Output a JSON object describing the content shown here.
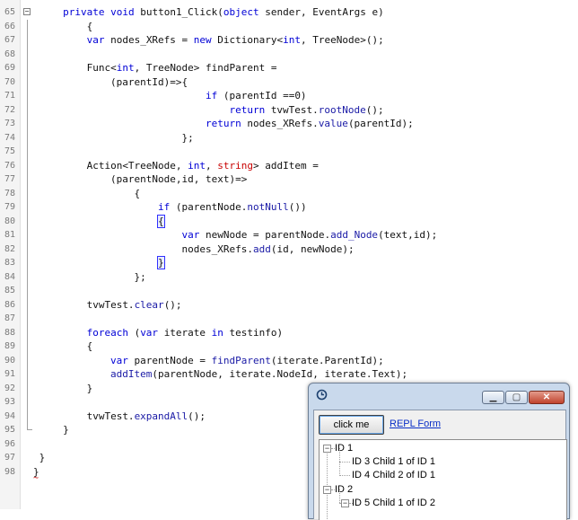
{
  "editor": {
    "lines": [
      {
        "num": "65",
        "indent": 5,
        "tokens": [
          {
            "c": "kw",
            "t": "private "
          },
          {
            "c": "kw",
            "t": "void "
          },
          {
            "c": "",
            "t": "button1_Click("
          },
          {
            "c": "kw",
            "t": "object "
          },
          {
            "c": "",
            "t": "sender, EventArgs e)"
          }
        ]
      },
      {
        "num": "66",
        "indent": 9,
        "tokens": [
          {
            "c": "",
            "t": "{"
          }
        ]
      },
      {
        "num": "67",
        "indent": 9,
        "tokens": [
          {
            "c": "kw",
            "t": "var "
          },
          {
            "c": "",
            "t": "nodes_XRefs = "
          },
          {
            "c": "kw",
            "t": "new "
          },
          {
            "c": "",
            "t": "Dictionary<"
          },
          {
            "c": "kw",
            "t": "int"
          },
          {
            "c": "",
            "t": ", TreeNode>();"
          }
        ]
      },
      {
        "num": "68",
        "indent": 0,
        "tokens": []
      },
      {
        "num": "69",
        "indent": 9,
        "tokens": [
          {
            "c": "",
            "t": "Func<"
          },
          {
            "c": "kw",
            "t": "int"
          },
          {
            "c": "",
            "t": ", TreeNode> findParent ="
          }
        ]
      },
      {
        "num": "70",
        "indent": 13,
        "tokens": [
          {
            "c": "",
            "t": "(parentId)=>{"
          }
        ]
      },
      {
        "num": "71",
        "indent": 29,
        "tokens": [
          {
            "c": "kw",
            "t": "if "
          },
          {
            "c": "",
            "t": "(parentId ==0)"
          }
        ]
      },
      {
        "num": "72",
        "indent": 33,
        "tokens": [
          {
            "c": "kw",
            "t": "return "
          },
          {
            "c": "",
            "t": "tvwTest."
          },
          {
            "c": "fn",
            "t": "rootNode"
          },
          {
            "c": "",
            "t": "();"
          }
        ]
      },
      {
        "num": "73",
        "indent": 29,
        "tokens": [
          {
            "c": "kw",
            "t": "return "
          },
          {
            "c": "",
            "t": "nodes_XRefs."
          },
          {
            "c": "fn",
            "t": "value"
          },
          {
            "c": "",
            "t": "(parentId);"
          }
        ]
      },
      {
        "num": "74",
        "indent": 25,
        "tokens": [
          {
            "c": "",
            "t": "};"
          }
        ]
      },
      {
        "num": "75",
        "indent": 0,
        "tokens": []
      },
      {
        "num": "76",
        "indent": 9,
        "tokens": [
          {
            "c": "",
            "t": "Action<TreeNode, "
          },
          {
            "c": "kw",
            "t": "int"
          },
          {
            "c": "",
            "t": ", "
          },
          {
            "c": "red",
            "t": "string"
          },
          {
            "c": "",
            "t": "> addItem ="
          }
        ]
      },
      {
        "num": "77",
        "indent": 13,
        "tokens": [
          {
            "c": "",
            "t": "(parentNode,id, text)=>"
          }
        ]
      },
      {
        "num": "78",
        "indent": 17,
        "tokens": [
          {
            "c": "",
            "t": "{"
          }
        ]
      },
      {
        "num": "79",
        "indent": 21,
        "tokens": [
          {
            "c": "kw",
            "t": "if "
          },
          {
            "c": "",
            "t": "(parentNode."
          },
          {
            "c": "fn",
            "t": "notNull"
          },
          {
            "c": "",
            "t": "())"
          }
        ]
      },
      {
        "num": "80",
        "indent": 21,
        "tokens": [
          {
            "c": "bracehl",
            "t": "{"
          }
        ]
      },
      {
        "num": "81",
        "indent": 25,
        "tokens": [
          {
            "c": "kw",
            "t": "var "
          },
          {
            "c": "",
            "t": "newNode = parentNode."
          },
          {
            "c": "fn",
            "t": "add_Node"
          },
          {
            "c": "",
            "t": "(text,id);"
          }
        ]
      },
      {
        "num": "82",
        "indent": 25,
        "tokens": [
          {
            "c": "",
            "t": "nodes_XRefs."
          },
          {
            "c": "fn",
            "t": "add"
          },
          {
            "c": "",
            "t": "(id, newNode);"
          }
        ]
      },
      {
        "num": "83",
        "indent": 21,
        "tokens": [
          {
            "c": "bracehl",
            "t": "}"
          }
        ]
      },
      {
        "num": "84",
        "indent": 17,
        "tokens": [
          {
            "c": "",
            "t": "};"
          }
        ]
      },
      {
        "num": "85",
        "indent": 0,
        "tokens": []
      },
      {
        "num": "86",
        "indent": 9,
        "tokens": [
          {
            "c": "",
            "t": "tvwTest."
          },
          {
            "c": "fn",
            "t": "clear"
          },
          {
            "c": "",
            "t": "();"
          }
        ]
      },
      {
        "num": "87",
        "indent": 0,
        "tokens": []
      },
      {
        "num": "88",
        "indent": 9,
        "tokens": [
          {
            "c": "kw",
            "t": "foreach "
          },
          {
            "c": "",
            "t": "("
          },
          {
            "c": "kw",
            "t": "var "
          },
          {
            "c": "",
            "t": "iterate "
          },
          {
            "c": "kw",
            "t": "in "
          },
          {
            "c": "",
            "t": "testinfo)"
          }
        ]
      },
      {
        "num": "89",
        "indent": 9,
        "tokens": [
          {
            "c": "",
            "t": "{"
          }
        ]
      },
      {
        "num": "90",
        "indent": 13,
        "tokens": [
          {
            "c": "kw",
            "t": "var "
          },
          {
            "c": "",
            "t": "parentNode = "
          },
          {
            "c": "fn",
            "t": "findParent"
          },
          {
            "c": "",
            "t": "(iterate.ParentId);"
          }
        ]
      },
      {
        "num": "91",
        "indent": 13,
        "tokens": [
          {
            "c": "fn",
            "t": "addItem"
          },
          {
            "c": "",
            "t": "(parentNode, iterate.NodeId, iterate.Text);"
          }
        ]
      },
      {
        "num": "92",
        "indent": 9,
        "tokens": [
          {
            "c": "",
            "t": "}"
          }
        ]
      },
      {
        "num": "93",
        "indent": 0,
        "tokens": []
      },
      {
        "num": "94",
        "indent": 9,
        "tokens": [
          {
            "c": "",
            "t": "tvwTest."
          },
          {
            "c": "fn",
            "t": "expandAll"
          },
          {
            "c": "",
            "t": "();"
          }
        ]
      },
      {
        "num": "95",
        "indent": 5,
        "tokens": [
          {
            "c": "",
            "t": "}"
          }
        ]
      },
      {
        "num": "96",
        "indent": 0,
        "tokens": []
      },
      {
        "num": "97",
        "indent": 1,
        "tokens": [
          {
            "c": "",
            "t": "}"
          }
        ]
      },
      {
        "num": "98",
        "indent": 0,
        "tokens": [
          {
            "c": "",
            "t": "}"
          }
        ]
      }
    ]
  },
  "form": {
    "title_icon": "app-icon",
    "minimize_glyph": "▁",
    "maximize_glyph": "▢",
    "close_glyph": "✕",
    "click_button": "click me",
    "repl_link": "REPL Form",
    "tree": [
      {
        "label": "ID 1",
        "level": 0,
        "expander": "−"
      },
      {
        "label": "ID 3 Child 1 of ID 1",
        "level": 1,
        "expander": ""
      },
      {
        "label": "ID 4 Child 2 of ID 1",
        "level": 1,
        "expander": ""
      },
      {
        "label": "ID 2",
        "level": 0,
        "expander": "−"
      },
      {
        "label": "ID 5 Child 1 of ID 2",
        "level": 1,
        "expander": "−"
      }
    ]
  },
  "colors": {
    "keyword": "#0000d6",
    "string_keyword": "#c80000",
    "window_frame": "#c9d9ec",
    "close_button": "#c0432d",
    "link": "#0a2fc7"
  }
}
